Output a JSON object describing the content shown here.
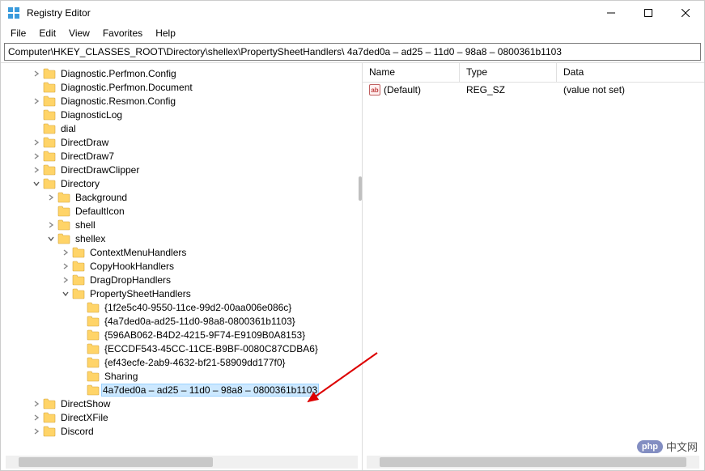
{
  "window": {
    "title": "Registry Editor"
  },
  "menu": {
    "file": "File",
    "edit": "Edit",
    "view": "View",
    "favorites": "Favorites",
    "help": "Help"
  },
  "address": "Computer\\HKEY_CLASSES_ROOT\\Directory\\shellex\\PropertySheetHandlers\\ 4a7ded0a – ad25 – 11d0 – 98a8 – 0800361b1103",
  "tree": [
    {
      "depth": 2,
      "chev": "closed",
      "label": "Diagnostic.Perfmon.Config"
    },
    {
      "depth": 2,
      "chev": "none",
      "label": "Diagnostic.Perfmon.Document"
    },
    {
      "depth": 2,
      "chev": "closed",
      "label": "Diagnostic.Resmon.Config"
    },
    {
      "depth": 2,
      "chev": "none",
      "label": "DiagnosticLog"
    },
    {
      "depth": 2,
      "chev": "none",
      "label": "dial"
    },
    {
      "depth": 2,
      "chev": "closed",
      "label": "DirectDraw"
    },
    {
      "depth": 2,
      "chev": "closed",
      "label": "DirectDraw7"
    },
    {
      "depth": 2,
      "chev": "closed",
      "label": "DirectDrawClipper"
    },
    {
      "depth": 2,
      "chev": "open",
      "label": "Directory"
    },
    {
      "depth": 3,
      "chev": "closed",
      "label": "Background"
    },
    {
      "depth": 3,
      "chev": "none",
      "label": "DefaultIcon"
    },
    {
      "depth": 3,
      "chev": "closed",
      "label": "shell"
    },
    {
      "depth": 3,
      "chev": "open",
      "label": "shellex"
    },
    {
      "depth": 4,
      "chev": "closed",
      "label": "ContextMenuHandlers"
    },
    {
      "depth": 4,
      "chev": "closed",
      "label": "CopyHookHandlers"
    },
    {
      "depth": 4,
      "chev": "closed",
      "label": "DragDropHandlers"
    },
    {
      "depth": 4,
      "chev": "open",
      "label": "PropertySheetHandlers"
    },
    {
      "depth": 5,
      "chev": "none",
      "label": "{1f2e5c40-9550-11ce-99d2-00aa006e086c}"
    },
    {
      "depth": 5,
      "chev": "none",
      "label": "{4a7ded0a-ad25-11d0-98a8-0800361b1103}"
    },
    {
      "depth": 5,
      "chev": "none",
      "label": "{596AB062-B4D2-4215-9F74-E9109B0A8153}"
    },
    {
      "depth": 5,
      "chev": "none",
      "label": "{ECCDF543-45CC-11CE-B9BF-0080C87CDBA6}"
    },
    {
      "depth": 5,
      "chev": "none",
      "label": "{ef43ecfe-2ab9-4632-bf21-58909dd177f0}"
    },
    {
      "depth": 5,
      "chev": "none",
      "label": "Sharing"
    },
    {
      "depth": 5,
      "chev": "none",
      "label": " 4a7ded0a – ad25 – 11d0 – 98a8 – 0800361b1103",
      "selected": true
    },
    {
      "depth": 2,
      "chev": "closed",
      "label": "DirectShow"
    },
    {
      "depth": 2,
      "chev": "closed",
      "label": "DirectXFile"
    },
    {
      "depth": 2,
      "chev": "closed",
      "label": "Discord"
    }
  ],
  "values": {
    "headers": {
      "name": "Name",
      "type": "Type",
      "data": "Data"
    },
    "rows": [
      {
        "name": "(Default)",
        "type": "REG_SZ",
        "data": "(value not set)"
      }
    ]
  },
  "watermark": {
    "badge": "php",
    "text": "中文网"
  }
}
